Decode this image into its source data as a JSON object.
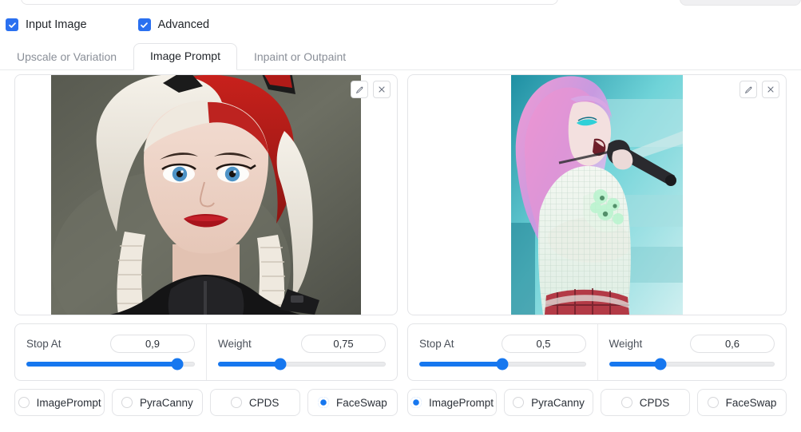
{
  "checkboxes": [
    {
      "label": "Input Image",
      "checked": true,
      "name": "input-image"
    },
    {
      "label": "Advanced",
      "checked": true,
      "name": "advanced"
    }
  ],
  "tabs": [
    {
      "label": "Upscale or Variation",
      "active": false
    },
    {
      "label": "Image Prompt",
      "active": true
    },
    {
      "label": "Inpaint or Outpaint",
      "active": false
    }
  ],
  "colors": {
    "accent": "#1677ef",
    "checkbox": "#2a70f0",
    "border": "#e3e4e7",
    "track": "#e9eaec",
    "text": "#1f2328",
    "muted": "#8a8f98"
  },
  "image_tools": [
    {
      "icon": "pencil-icon",
      "title": "Edit"
    },
    {
      "icon": "close-icon",
      "title": "Remove"
    }
  ],
  "panels": [
    {
      "id": "left",
      "image_alt": "Portrait of woman with white and red hair, blue eyes, red lips, black outfit",
      "sliders": [
        {
          "label": "Stop At",
          "value": "0,9",
          "percent": 90
        },
        {
          "label": "Weight",
          "value": "0,75",
          "percent": 37
        }
      ],
      "modes": [
        {
          "label": "ImagePrompt",
          "selected": false
        },
        {
          "label": "PyraCanny",
          "selected": false
        },
        {
          "label": "CPDS",
          "selected": false
        },
        {
          "label": "FaceSwap",
          "selected": true
        }
      ]
    },
    {
      "id": "right",
      "image_alt": "Singer with pink and purple hair holding a microphone on stage",
      "sliders": [
        {
          "label": "Stop At",
          "value": "0,5",
          "percent": 50
        },
        {
          "label": "Weight",
          "value": "0,6",
          "percent": 31
        }
      ],
      "modes": [
        {
          "label": "ImagePrompt",
          "selected": true
        },
        {
          "label": "PyraCanny",
          "selected": false
        },
        {
          "label": "CPDS",
          "selected": false
        },
        {
          "label": "FaceSwap",
          "selected": false
        }
      ]
    }
  ]
}
